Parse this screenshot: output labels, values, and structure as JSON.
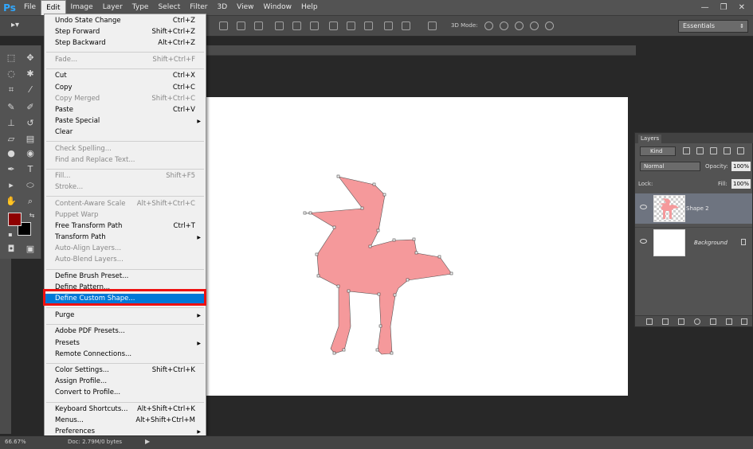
{
  "app": {
    "logo": "Ps",
    "menus": [
      "File",
      "Edit",
      "Image",
      "Layer",
      "Type",
      "Select",
      "Filter",
      "3D",
      "View",
      "Window",
      "Help"
    ],
    "active_menu": "Edit",
    "window_controls": [
      "—",
      "❐",
      "✕"
    ]
  },
  "options_bar": {
    "mode_3d_label": "3D Mode:",
    "workspace": "Essentials"
  },
  "edit_menu": [
    {
      "label": "Undo State Change",
      "shortcut": "Ctrl+Z",
      "disabled": false
    },
    {
      "label": "Step Forward",
      "shortcut": "Shift+Ctrl+Z",
      "disabled": false
    },
    {
      "label": "Step Backward",
      "shortcut": "Alt+Ctrl+Z",
      "disabled": false
    },
    {
      "separator": true
    },
    {
      "label": "Fade...",
      "shortcut": "Shift+Ctrl+F",
      "disabled": true
    },
    {
      "separator": true
    },
    {
      "label": "Cut",
      "shortcut": "Ctrl+X",
      "disabled": false
    },
    {
      "label": "Copy",
      "shortcut": "Ctrl+C",
      "disabled": false
    },
    {
      "label": "Copy Merged",
      "shortcut": "Shift+Ctrl+C",
      "disabled": true
    },
    {
      "label": "Paste",
      "shortcut": "Ctrl+V",
      "disabled": false
    },
    {
      "label": "Paste Special",
      "shortcut": "",
      "disabled": false,
      "submenu": true
    },
    {
      "label": "Clear",
      "shortcut": "",
      "disabled": false
    },
    {
      "separator": true
    },
    {
      "label": "Check Spelling...",
      "shortcut": "",
      "disabled": true
    },
    {
      "label": "Find and Replace Text...",
      "shortcut": "",
      "disabled": true
    },
    {
      "separator": true
    },
    {
      "label": "Fill...",
      "shortcut": "Shift+F5",
      "disabled": true
    },
    {
      "label": "Stroke...",
      "shortcut": "",
      "disabled": true
    },
    {
      "separator": true
    },
    {
      "label": "Content-Aware Scale",
      "shortcut": "Alt+Shift+Ctrl+C",
      "disabled": true
    },
    {
      "label": "Puppet Warp",
      "shortcut": "",
      "disabled": true
    },
    {
      "label": "Free Transform Path",
      "shortcut": "Ctrl+T",
      "disabled": false
    },
    {
      "label": "Transform Path",
      "shortcut": "",
      "disabled": false,
      "submenu": true
    },
    {
      "label": "Auto-Align Layers...",
      "shortcut": "",
      "disabled": true
    },
    {
      "label": "Auto-Blend Layers...",
      "shortcut": "",
      "disabled": true
    },
    {
      "separator": true
    },
    {
      "label": "Define Brush Preset...",
      "shortcut": "",
      "disabled": false
    },
    {
      "label": "Define Pattern...",
      "shortcut": "",
      "disabled": false
    },
    {
      "label": "Define Custom Shape...",
      "shortcut": "",
      "disabled": false,
      "highlighted": true
    },
    {
      "separator": true
    },
    {
      "label": "Purge",
      "shortcut": "",
      "disabled": false,
      "submenu": true
    },
    {
      "separator": true
    },
    {
      "label": "Adobe PDF Presets...",
      "shortcut": "",
      "disabled": false
    },
    {
      "label": "Presets",
      "shortcut": "",
      "disabled": false,
      "submenu": true
    },
    {
      "label": "Remote Connections...",
      "shortcut": "",
      "disabled": false
    },
    {
      "separator": true
    },
    {
      "label": "Color Settings...",
      "shortcut": "Shift+Ctrl+K",
      "disabled": false
    },
    {
      "label": "Assign Profile...",
      "shortcut": "",
      "disabled": false
    },
    {
      "label": "Convert to Profile...",
      "shortcut": "",
      "disabled": false
    },
    {
      "separator": true
    },
    {
      "label": "Keyboard Shortcuts...",
      "shortcut": "Alt+Shift+Ctrl+K",
      "disabled": false
    },
    {
      "label": "Menus...",
      "shortcut": "Alt+Shift+Ctrl+M",
      "disabled": false
    },
    {
      "label": "Preferences",
      "shortcut": "",
      "disabled": false,
      "submenu": true
    }
  ],
  "status": {
    "zoom": "66.67%",
    "doc_info": "Doc: 2.79M/0 bytes"
  },
  "colors": {
    "foreground": "#8e0000",
    "background": "#000000",
    "shape_fill": "#f5999b",
    "highlight": "#0078d7"
  },
  "layers_panel": {
    "tab": "Layers",
    "kind": "Kind",
    "blend_mode": "Normal",
    "opacity_label": "Opacity:",
    "opacity_value": "100%",
    "lock_label": "Lock:",
    "fill_label": "Fill:",
    "fill_value": "100%",
    "layers": [
      {
        "name": "Shape 2",
        "selected": true
      },
      {
        "name": "Background",
        "selected": false
      }
    ]
  }
}
